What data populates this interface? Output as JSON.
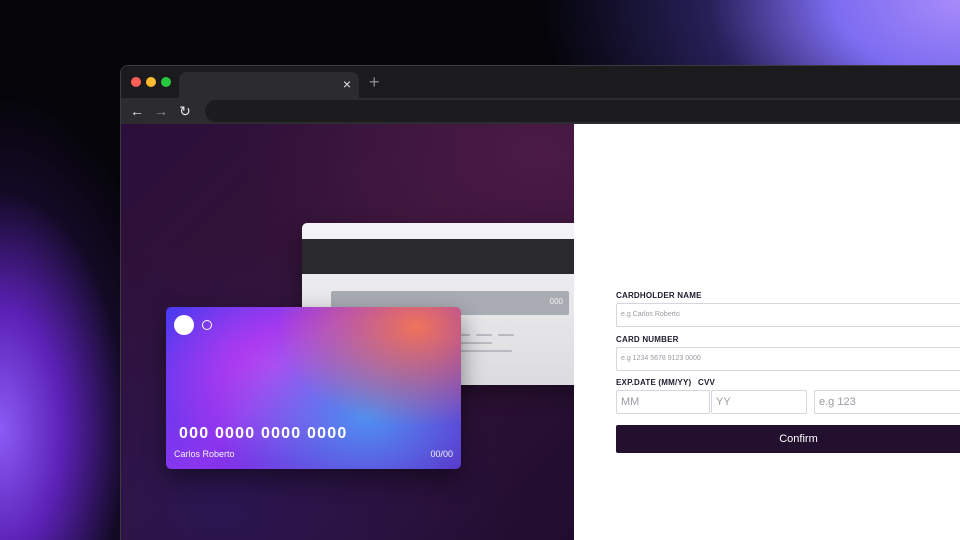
{
  "browser": {
    "tab": {
      "close_glyph": "×"
    },
    "new_tab_glyph": "+",
    "nav": {
      "back_glyph": "←",
      "forward_glyph": "→",
      "reload_glyph": "↻"
    },
    "url": ""
  },
  "card_back": {
    "cvv": "000"
  },
  "card_front": {
    "number": "000 0000 0000 0000",
    "holder": "Carlos Roberto",
    "expiry": "00/00"
  },
  "form": {
    "cardholder_label": "CARDHOLDER NAME",
    "cardholder_placeholder": "e.g Carlos Roberto",
    "number_label": "CARD NUMBER",
    "number_placeholder": "e.g 1234 5678 9123 0000",
    "exp_label": "EXP.DATE (MM/YY)",
    "cvv_label": "CVV",
    "mm_placeholder": "MM",
    "yy_placeholder": "YY",
    "cvv_placeholder": "e.g 123",
    "confirm_label": "Confirm"
  },
  "colors": {
    "accent_dark": "#23102f",
    "left_panel": "#2b0f3a",
    "card_gradient_start": "#4a3aef"
  }
}
